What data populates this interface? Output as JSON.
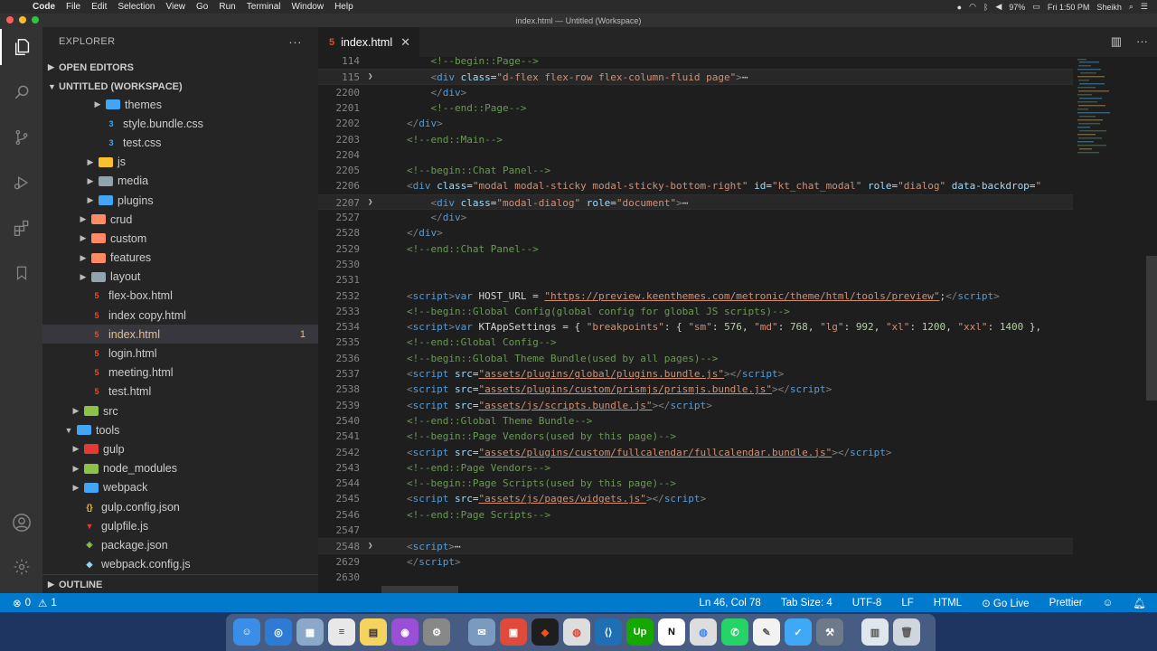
{
  "menubar": {
    "app": "Code",
    "items": [
      "File",
      "Edit",
      "Selection",
      "View",
      "Go",
      "Run",
      "Terminal",
      "Window",
      "Help"
    ],
    "battery": "97%",
    "clock": "Fri 1:50 PM",
    "user": "Sheikh"
  },
  "window": {
    "title": "index.html — Untitled (Workspace)"
  },
  "sidebar": {
    "header": "EXPLORER",
    "sections": {
      "open_editors": "OPEN EDITORS",
      "workspace": "UNTITLED (WORKSPACE)",
      "outline": "OUTLINE"
    },
    "tree": [
      {
        "name": "themes",
        "kind": "folder",
        "depth": 4,
        "icon": "folder-themes"
      },
      {
        "name": "style.bundle.css",
        "kind": "css",
        "depth": 4
      },
      {
        "name": "test.css",
        "kind": "css",
        "depth": 4
      },
      {
        "name": "js",
        "kind": "folder",
        "depth": 3,
        "icon": "folder-js"
      },
      {
        "name": "media",
        "kind": "folder",
        "depth": 3
      },
      {
        "name": "plugins",
        "kind": "folder",
        "depth": 3
      },
      {
        "name": "crud",
        "kind": "folder",
        "depth": 2
      },
      {
        "name": "custom",
        "kind": "folder",
        "depth": 2
      },
      {
        "name": "features",
        "kind": "folder",
        "depth": 2
      },
      {
        "name": "layout",
        "kind": "folder",
        "depth": 2
      },
      {
        "name": "flex-box.html",
        "kind": "html",
        "depth": 2
      },
      {
        "name": "index copy.html",
        "kind": "html",
        "depth": 2
      },
      {
        "name": "index.html",
        "kind": "html",
        "depth": 2,
        "selected": true,
        "badge": "1"
      },
      {
        "name": "login.html",
        "kind": "html",
        "depth": 2
      },
      {
        "name": "meeting.html",
        "kind": "html",
        "depth": 2
      },
      {
        "name": "test.html",
        "kind": "html",
        "depth": 2
      },
      {
        "name": "src",
        "kind": "folder",
        "depth": 1
      },
      {
        "name": "tools",
        "kind": "folder-open",
        "depth": 0
      },
      {
        "name": "gulp",
        "kind": "folder",
        "depth": 1
      },
      {
        "name": "node_modules",
        "kind": "folder",
        "depth": 1
      },
      {
        "name": "webpack",
        "kind": "folder",
        "depth": 1
      },
      {
        "name": "gulp.config.json",
        "kind": "json",
        "depth": 1
      },
      {
        "name": "gulpfile.js",
        "kind": "gulp",
        "depth": 1
      },
      {
        "name": "package.json",
        "kind": "npm",
        "depth": 1
      },
      {
        "name": "webpack.config.js",
        "kind": "webpack",
        "depth": 1
      }
    ]
  },
  "tab": {
    "label": "index.html"
  },
  "editor": {
    "lines": [
      {
        "n": "114",
        "tokens": [
          [
            "c-com",
            "    <!--begin::Page-->"
          ]
        ]
      },
      {
        "n": "115",
        "fold": true,
        "hl": true,
        "tokens": [
          [
            "c-gr",
            "    <"
          ],
          [
            "c-tag",
            "div"
          ],
          [
            "c-att",
            " class"
          ],
          [
            "c-txt",
            "="
          ],
          [
            "c-str",
            "\"d-flex flex-row flex-column-fluid page\""
          ],
          [
            "c-gr",
            ">"
          ],
          [
            "c-txt",
            "⋯"
          ]
        ]
      },
      {
        "n": "2200",
        "tokens": [
          [
            "c-gr",
            "    </"
          ],
          [
            "c-tag",
            "div"
          ],
          [
            "c-gr",
            ">"
          ]
        ]
      },
      {
        "n": "2201",
        "tokens": [
          [
            "c-com",
            "    <!--end::Page-->"
          ]
        ]
      },
      {
        "n": "2202",
        "tokens": [
          [
            "c-gr",
            "</"
          ],
          [
            "c-tag",
            "div"
          ],
          [
            "c-gr",
            ">"
          ]
        ]
      },
      {
        "n": "2203",
        "tokens": [
          [
            "c-com",
            "<!--end::Main-->"
          ]
        ]
      },
      {
        "n": "2204",
        "tokens": []
      },
      {
        "n": "2205",
        "tokens": [
          [
            "c-com",
            "<!--begin::Chat Panel-->"
          ]
        ]
      },
      {
        "n": "2206",
        "tokens": [
          [
            "c-gr",
            "<"
          ],
          [
            "c-tag",
            "div"
          ],
          [
            "c-att",
            " class"
          ],
          [
            "c-txt",
            "="
          ],
          [
            "c-str",
            "\"modal modal-sticky modal-sticky-bottom-right\""
          ],
          [
            "c-att",
            " id"
          ],
          [
            "c-txt",
            "="
          ],
          [
            "c-str",
            "\"kt_chat_modal\""
          ],
          [
            "c-att",
            " role"
          ],
          [
            "c-txt",
            "="
          ],
          [
            "c-str",
            "\"dialog\""
          ],
          [
            "c-att",
            " data-backdrop"
          ],
          [
            "c-txt",
            "="
          ],
          [
            "c-str",
            "\""
          ]
        ]
      },
      {
        "n": "2207",
        "fold": true,
        "hl": true,
        "tokens": [
          [
            "c-gr",
            "    <"
          ],
          [
            "c-tag",
            "div"
          ],
          [
            "c-att",
            " class"
          ],
          [
            "c-txt",
            "="
          ],
          [
            "c-str",
            "\"modal-dialog\""
          ],
          [
            "c-att",
            " role"
          ],
          [
            "c-txt",
            "="
          ],
          [
            "c-str",
            "\"document\""
          ],
          [
            "c-gr",
            ">"
          ],
          [
            "c-txt",
            "⋯"
          ]
        ]
      },
      {
        "n": "2527",
        "tokens": [
          [
            "c-gr",
            "    </"
          ],
          [
            "c-tag",
            "div"
          ],
          [
            "c-gr",
            ">"
          ]
        ]
      },
      {
        "n": "2528",
        "tokens": [
          [
            "c-gr",
            "</"
          ],
          [
            "c-tag",
            "div"
          ],
          [
            "c-gr",
            ">"
          ]
        ]
      },
      {
        "n": "2529",
        "tokens": [
          [
            "c-com",
            "<!--end::Chat Panel-->"
          ]
        ]
      },
      {
        "n": "2530",
        "tokens": []
      },
      {
        "n": "2531",
        "tokens": []
      },
      {
        "n": "2532",
        "tokens": [
          [
            "c-gr",
            "<"
          ],
          [
            "c-tag",
            "script"
          ],
          [
            "c-gr",
            ">"
          ],
          [
            "c-tag",
            "var"
          ],
          [
            "c-txt",
            " HOST_URL = "
          ],
          [
            "c-link",
            "\"https://preview.keenthemes.com/metronic/theme/html/tools/preview\""
          ],
          [
            "c-txt",
            ";"
          ],
          [
            "c-gr",
            "</"
          ],
          [
            "c-tag",
            "script"
          ],
          [
            "c-gr",
            ">"
          ]
        ]
      },
      {
        "n": "2533",
        "tokens": [
          [
            "c-com",
            "<!--begin::Global Config(global config for global JS scripts)-->"
          ]
        ]
      },
      {
        "n": "2534",
        "tokens": [
          [
            "c-gr",
            "<"
          ],
          [
            "c-tag",
            "script"
          ],
          [
            "c-gr",
            ">"
          ],
          [
            "c-tag",
            "var"
          ],
          [
            "c-txt",
            " KTAppSettings = { "
          ],
          [
            "c-str",
            "\"breakpoints\""
          ],
          [
            "c-txt",
            ": { "
          ],
          [
            "c-str",
            "\"sm\""
          ],
          [
            "c-txt",
            ": "
          ],
          [
            "c-num",
            "576"
          ],
          [
            "c-txt",
            ", "
          ],
          [
            "c-str",
            "\"md\""
          ],
          [
            "c-txt",
            ": "
          ],
          [
            "c-num",
            "768"
          ],
          [
            "c-txt",
            ", "
          ],
          [
            "c-str",
            "\"lg\""
          ],
          [
            "c-txt",
            ": "
          ],
          [
            "c-num",
            "992"
          ],
          [
            "c-txt",
            ", "
          ],
          [
            "c-str",
            "\"xl\""
          ],
          [
            "c-txt",
            ": "
          ],
          [
            "c-num",
            "1200"
          ],
          [
            "c-txt",
            ", "
          ],
          [
            "c-str",
            "\"xxl\""
          ],
          [
            "c-txt",
            ": "
          ],
          [
            "c-num",
            "1400"
          ],
          [
            "c-txt",
            " },"
          ]
        ]
      },
      {
        "n": "2535",
        "tokens": [
          [
            "c-com",
            "<!--end::Global Config-->"
          ]
        ]
      },
      {
        "n": "2536",
        "tokens": [
          [
            "c-com",
            "<!--begin::Global Theme Bundle(used by all pages)-->"
          ]
        ]
      },
      {
        "n": "2537",
        "tokens": [
          [
            "c-gr",
            "<"
          ],
          [
            "c-tag",
            "script"
          ],
          [
            "c-att",
            " src"
          ],
          [
            "c-txt",
            "="
          ],
          [
            "c-link",
            "\"assets/plugins/global/plugins.bundle.js\""
          ],
          [
            "c-gr",
            "></"
          ],
          [
            "c-tag",
            "script"
          ],
          [
            "c-gr",
            ">"
          ]
        ]
      },
      {
        "n": "2538",
        "tokens": [
          [
            "c-gr",
            "<"
          ],
          [
            "c-tag",
            "script"
          ],
          [
            "c-att",
            " src"
          ],
          [
            "c-txt",
            "="
          ],
          [
            "c-link",
            "\"assets/plugins/custom/prismjs/prismjs.bundle.js\""
          ],
          [
            "c-gr",
            "></"
          ],
          [
            "c-tag",
            "script"
          ],
          [
            "c-gr",
            ">"
          ]
        ]
      },
      {
        "n": "2539",
        "tokens": [
          [
            "c-gr",
            "<"
          ],
          [
            "c-tag",
            "script"
          ],
          [
            "c-att",
            " src"
          ],
          [
            "c-txt",
            "="
          ],
          [
            "c-link",
            "\"assets/js/scripts.bundle.js\""
          ],
          [
            "c-gr",
            "></"
          ],
          [
            "c-tag",
            "script"
          ],
          [
            "c-gr",
            ">"
          ]
        ]
      },
      {
        "n": "2540",
        "tokens": [
          [
            "c-com",
            "<!--end::Global Theme Bundle-->"
          ]
        ]
      },
      {
        "n": "2541",
        "tokens": [
          [
            "c-com",
            "<!--begin::Page Vendors(used by this page)-->"
          ]
        ]
      },
      {
        "n": "2542",
        "tokens": [
          [
            "c-gr",
            "<"
          ],
          [
            "c-tag",
            "script"
          ],
          [
            "c-att",
            " src"
          ],
          [
            "c-txt",
            "="
          ],
          [
            "c-link",
            "\"assets/plugins/custom/fullcalendar/fullcalendar.bundle.js\""
          ],
          [
            "c-gr",
            "></"
          ],
          [
            "c-tag",
            "script"
          ],
          [
            "c-gr",
            ">"
          ]
        ]
      },
      {
        "n": "2543",
        "tokens": [
          [
            "c-com",
            "<!--end::Page Vendors-->"
          ]
        ]
      },
      {
        "n": "2544",
        "tokens": [
          [
            "c-com",
            "<!--begin::Page Scripts(used by this page)-->"
          ]
        ]
      },
      {
        "n": "2545",
        "tokens": [
          [
            "c-gr",
            "<"
          ],
          [
            "c-tag",
            "script"
          ],
          [
            "c-att",
            " src"
          ],
          [
            "c-txt",
            "="
          ],
          [
            "c-link",
            "\"assets/js/pages/widgets.js\""
          ],
          [
            "c-gr",
            "></"
          ],
          [
            "c-tag",
            "script"
          ],
          [
            "c-gr",
            ">"
          ]
        ]
      },
      {
        "n": "2546",
        "tokens": [
          [
            "c-com",
            "<!--end::Page Scripts-->"
          ]
        ]
      },
      {
        "n": "2547",
        "tokens": []
      },
      {
        "n": "2548",
        "fold": true,
        "hl": true,
        "tokens": [
          [
            "c-gr",
            "<"
          ],
          [
            "c-tag",
            "script"
          ],
          [
            "c-gr",
            ">"
          ],
          [
            "c-txt",
            "⋯"
          ]
        ]
      },
      {
        "n": "2629",
        "tokens": [
          [
            "c-gr",
            "</"
          ],
          [
            "c-tag",
            "script"
          ],
          [
            "c-gr",
            ">"
          ]
        ]
      },
      {
        "n": "2630",
        "tokens": []
      }
    ]
  },
  "status": {
    "problems": "0",
    "warnings": "1",
    "position": "Ln 46, Col 78",
    "tab_size": "Tab Size: 4",
    "encoding": "UTF-8",
    "eol": "LF",
    "language": "HTML",
    "golive": "Go Live",
    "prettier": "Prettier"
  },
  "colors": {
    "statusbar": "#007acc",
    "html_icon": "#e44d26",
    "css_icon": "#42a5f5",
    "folder": "#90a4ae"
  }
}
